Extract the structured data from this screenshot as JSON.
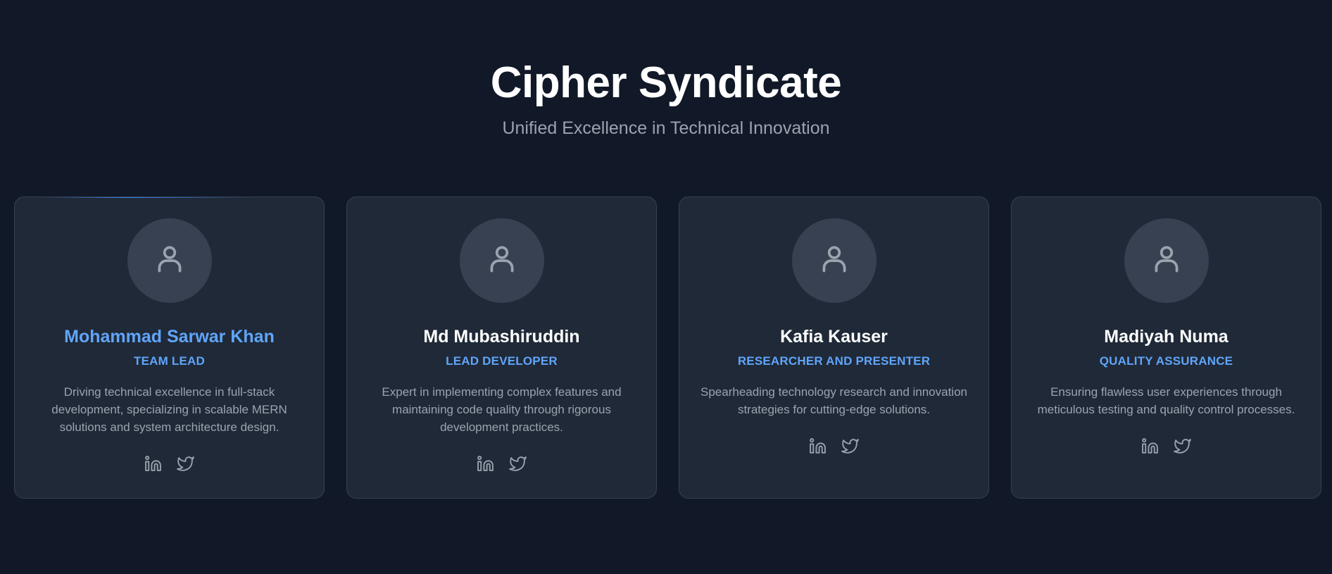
{
  "header": {
    "title": "Cipher Syndicate",
    "subtitle": "Unified Excellence in Technical Innovation"
  },
  "theme": {
    "background": "#111827",
    "card": "#1f2937",
    "accent": "#60a5fa",
    "muted": "#9ca3af"
  },
  "members": [
    {
      "name": "Mohammad Sarwar Khan",
      "role": "TEAM LEAD",
      "description": "Driving technical excellence in full-stack development, specializing in scalable MERN solutions and system architecture design.",
      "avatar_icon": "user-icon",
      "social_icons": [
        "linkedin-icon",
        "twitter-icon"
      ],
      "highlighted": true
    },
    {
      "name": "Md Mubashiruddin",
      "role": "LEAD DEVELOPER",
      "description": "Expert in implementing complex features and maintaining code quality through rigorous development practices.",
      "avatar_icon": "user-icon",
      "social_icons": [
        "linkedin-icon",
        "twitter-icon"
      ],
      "highlighted": false
    },
    {
      "name": "Kafia Kauser",
      "role": "RESEARCHER AND PRESENTER",
      "description": "Spearheading technology research and innovation strategies for cutting-edge solutions.",
      "avatar_icon": "user-icon",
      "social_icons": [
        "linkedin-icon",
        "twitter-icon"
      ],
      "highlighted": false
    },
    {
      "name": "Madiyah Numa",
      "role": "QUALITY ASSURANCE",
      "description": "Ensuring flawless user experiences through meticulous testing and quality control processes.",
      "avatar_icon": "user-icon",
      "social_icons": [
        "linkedin-icon",
        "twitter-icon"
      ],
      "highlighted": false
    }
  ]
}
